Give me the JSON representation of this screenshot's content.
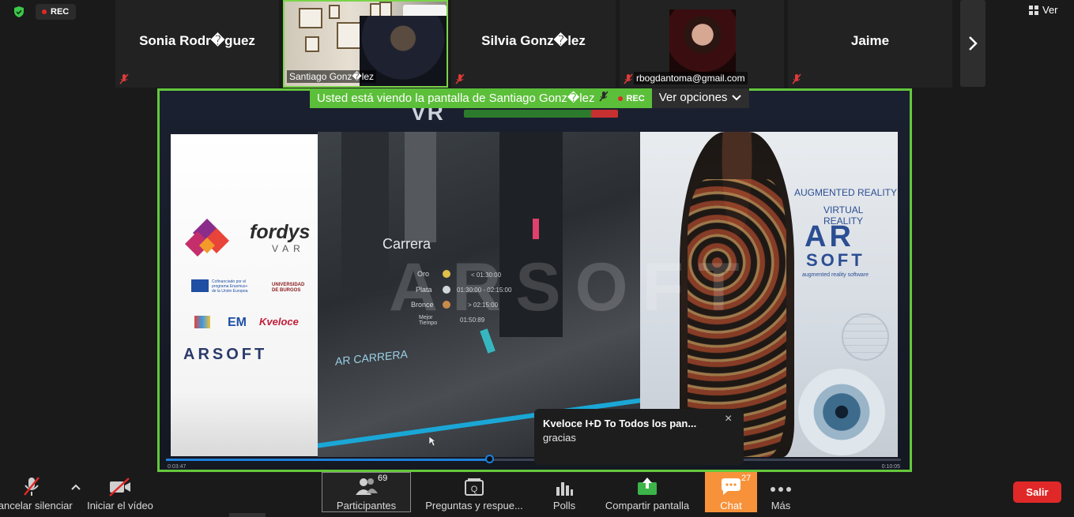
{
  "top": {
    "rec_label": "REC",
    "view_label": "Ver",
    "tiles": [
      {
        "name": "Sonia Rodr�guez",
        "type": "name"
      },
      {
        "name": "Santiago Gonz�lez",
        "type": "video"
      },
      {
        "name": "Silvia Gonz�lez",
        "type": "name"
      },
      {
        "name": "rbogdantoma@gmail.com",
        "type": "photo"
      },
      {
        "name": "Jaime",
        "type": "name"
      }
    ]
  },
  "banner": {
    "viewing_text": "Usted está viendo la pantalla de Santiago Gonz�lez",
    "rec_label": "REC",
    "options_label": "Ver opciones"
  },
  "shared_screen": {
    "vr_title": "VR",
    "left_panel": {
      "brand": "fordys",
      "brand_sub": "VAR",
      "eu_text": "Cofinanciado por el programa Erasmus+ de la Unión Europea",
      "university": "UNIVERSIDAD DE BURGOS",
      "logo_em": "EM",
      "logo_kveloce": "Kveloce",
      "arsoft": "ARSOFT"
    },
    "middle_panel": {
      "heading": "Carrera",
      "ranks": [
        {
          "label": "Oro",
          "time": "< 01:30:00"
        },
        {
          "label": "Plata",
          "time": "01:30:00 - 02:15:00"
        },
        {
          "label": "Bronce",
          "time": "> 02:15:00"
        },
        {
          "label": "Mejor Tiempo",
          "time": "01:50:89"
        }
      ],
      "start_label": "AR CARRERA",
      "watermark": "ARSOFT"
    },
    "right_panel": {
      "aug": "AUGMENTED REALITY",
      "vr": "VIRTUAL REALITY",
      "ar": "AR",
      "soft": "SOFT",
      "tagline": "augmented reality software"
    },
    "time_start": "0:03:47",
    "time_end": "0:10:05",
    "progress_fraction": 0.44
  },
  "chat_toast": {
    "title": "Kveloce I+D To Todos los pan...",
    "message": "gracias"
  },
  "toolbar": {
    "mute_label": "Cancelar silenciar",
    "video_label": "Iniciar el vídeo",
    "participants_label": "Participantes",
    "participants_count": "69",
    "qa_label": "Preguntas y respue...",
    "polls_label": "Polls",
    "share_label": "Compartir pantalla",
    "chat_label": "Chat",
    "chat_count": "27",
    "more_label": "Más",
    "leave_label": "Salir"
  },
  "colors": {
    "accent_green": "#5cbf3a",
    "chat_orange": "#f7923a",
    "leave_red": "#e02828",
    "background": "#1a1a1a"
  }
}
